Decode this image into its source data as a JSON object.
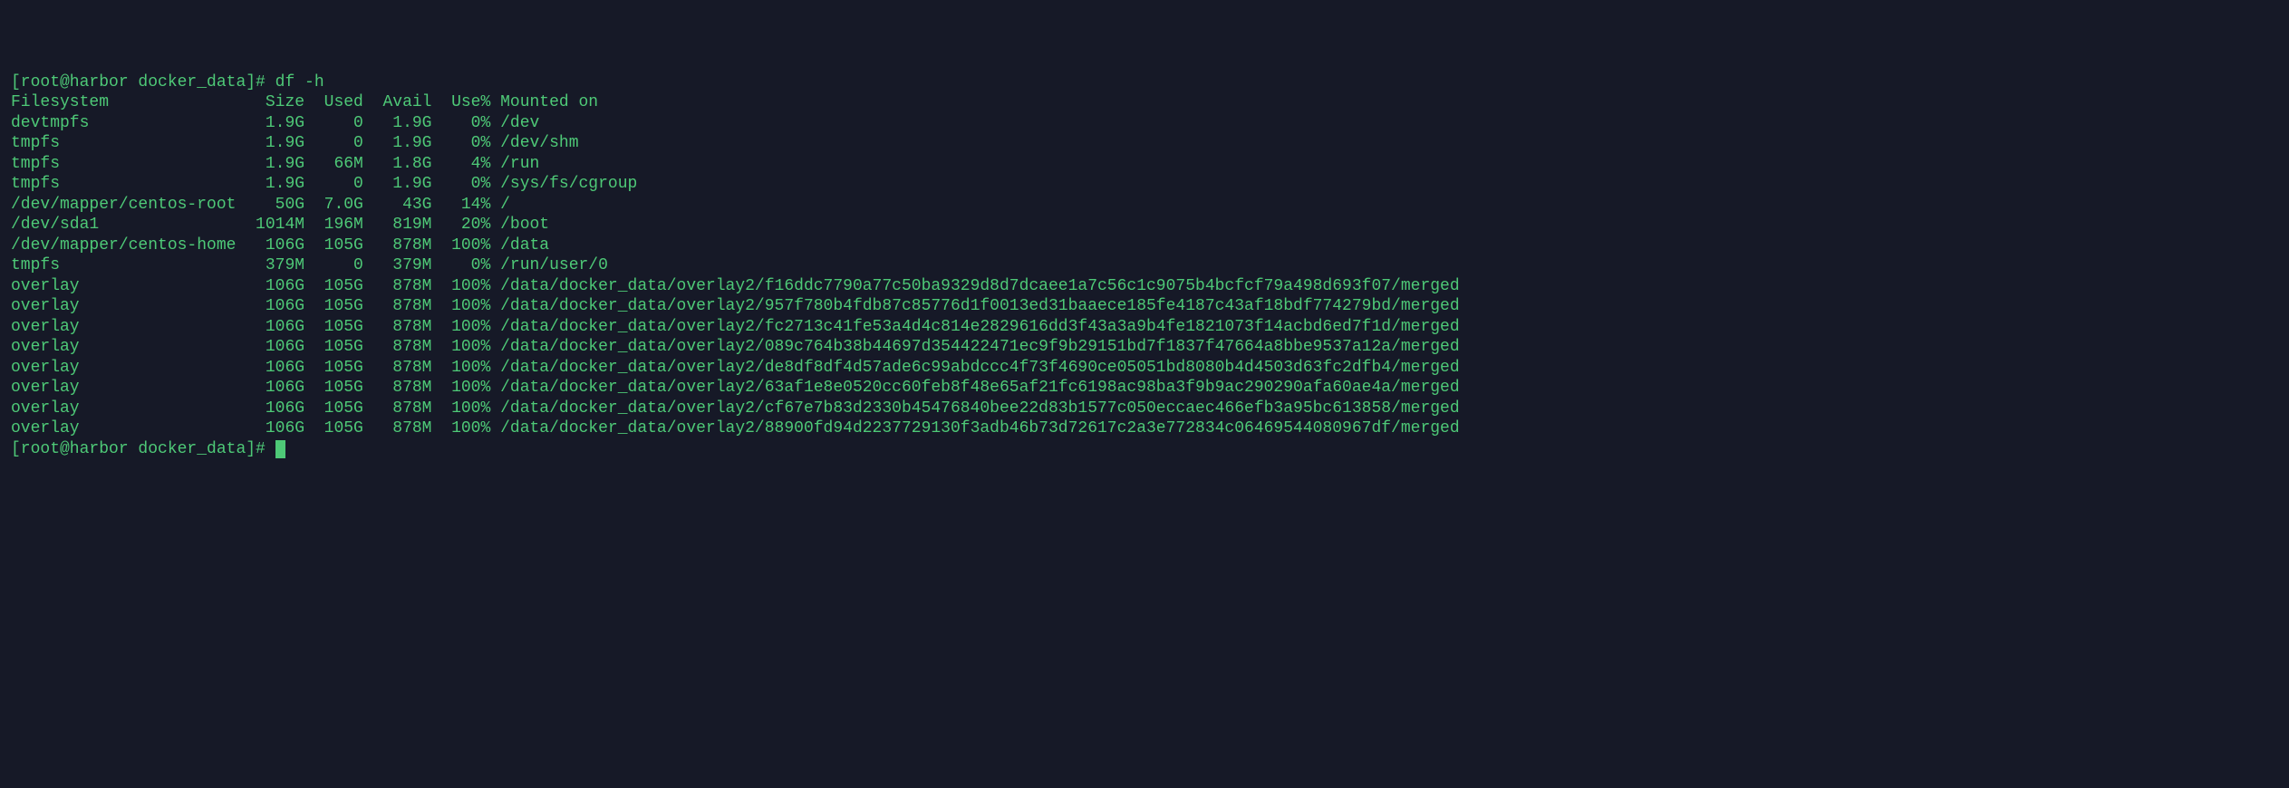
{
  "terminal": {
    "prompt1": "[root@harbor docker_data]# ",
    "command1": "df -h",
    "prompt2": "[root@harbor docker_data]# ",
    "header": {
      "filesystem": "Filesystem",
      "size": "Size",
      "used": "Used",
      "avail": "Avail",
      "usepct": "Use%",
      "mounted": "Mounted on"
    },
    "rows": [
      {
        "fs": "devtmpfs",
        "size": "1.9G",
        "used": "0",
        "avail": "1.9G",
        "usepct": "0%",
        "mount": "/dev"
      },
      {
        "fs": "tmpfs",
        "size": "1.9G",
        "used": "0",
        "avail": "1.9G",
        "usepct": "0%",
        "mount": "/dev/shm"
      },
      {
        "fs": "tmpfs",
        "size": "1.9G",
        "used": "66M",
        "avail": "1.8G",
        "usepct": "4%",
        "mount": "/run"
      },
      {
        "fs": "tmpfs",
        "size": "1.9G",
        "used": "0",
        "avail": "1.9G",
        "usepct": "0%",
        "mount": "/sys/fs/cgroup"
      },
      {
        "fs": "/dev/mapper/centos-root",
        "size": "50G",
        "used": "7.0G",
        "avail": "43G",
        "usepct": "14%",
        "mount": "/"
      },
      {
        "fs": "/dev/sda1",
        "size": "1014M",
        "used": "196M",
        "avail": "819M",
        "usepct": "20%",
        "mount": "/boot"
      },
      {
        "fs": "/dev/mapper/centos-home",
        "size": "106G",
        "used": "105G",
        "avail": "878M",
        "usepct": "100%",
        "mount": "/data"
      },
      {
        "fs": "tmpfs",
        "size": "379M",
        "used": "0",
        "avail": "379M",
        "usepct": "0%",
        "mount": "/run/user/0"
      },
      {
        "fs": "overlay",
        "size": "106G",
        "used": "105G",
        "avail": "878M",
        "usepct": "100%",
        "mount": "/data/docker_data/overlay2/f16ddc7790a77c50ba9329d8d7dcaee1a7c56c1c9075b4bcfcf79a498d693f07/merged"
      },
      {
        "fs": "overlay",
        "size": "106G",
        "used": "105G",
        "avail": "878M",
        "usepct": "100%",
        "mount": "/data/docker_data/overlay2/957f780b4fdb87c85776d1f0013ed31baaece185fe4187c43af18bdf774279bd/merged"
      },
      {
        "fs": "overlay",
        "size": "106G",
        "used": "105G",
        "avail": "878M",
        "usepct": "100%",
        "mount": "/data/docker_data/overlay2/fc2713c41fe53a4d4c814e2829616dd3f43a3a9b4fe1821073f14acbd6ed7f1d/merged"
      },
      {
        "fs": "overlay",
        "size": "106G",
        "used": "105G",
        "avail": "878M",
        "usepct": "100%",
        "mount": "/data/docker_data/overlay2/089c764b38b44697d354422471ec9f9b29151bd7f1837f47664a8bbe9537a12a/merged"
      },
      {
        "fs": "overlay",
        "size": "106G",
        "used": "105G",
        "avail": "878M",
        "usepct": "100%",
        "mount": "/data/docker_data/overlay2/de8df8df4d57ade6c99abdccc4f73f4690ce05051bd8080b4d4503d63fc2dfb4/merged"
      },
      {
        "fs": "overlay",
        "size": "106G",
        "used": "105G",
        "avail": "878M",
        "usepct": "100%",
        "mount": "/data/docker_data/overlay2/63af1e8e0520cc60feb8f48e65af21fc6198ac98ba3f9b9ac290290afa60ae4a/merged"
      },
      {
        "fs": "overlay",
        "size": "106G",
        "used": "105G",
        "avail": "878M",
        "usepct": "100%",
        "mount": "/data/docker_data/overlay2/cf67e7b83d2330b45476840bee22d83b1577c050eccaec466efb3a95bc613858/merged"
      },
      {
        "fs": "overlay",
        "size": "106G",
        "used": "105G",
        "avail": "878M",
        "usepct": "100%",
        "mount": "/data/docker_data/overlay2/88900fd94d2237729130f3adb46b73d72617c2a3e772834c06469544080967df/merged"
      }
    ]
  }
}
